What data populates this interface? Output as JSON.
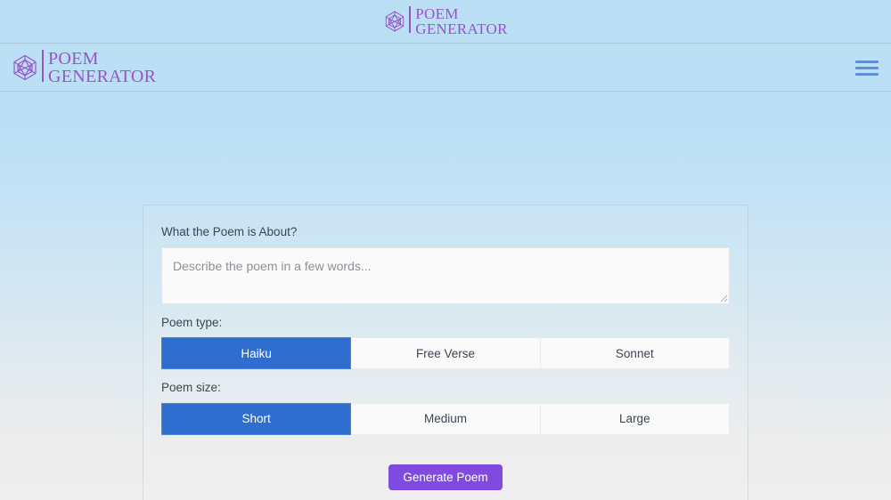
{
  "banner": {
    "logo": {
      "icon": "polyhedron-icon",
      "line1": "POEM",
      "line2": "GENERATOR",
      "color": "#9b52c9"
    }
  },
  "navbar": {
    "logo": {
      "icon": "polyhedron-icon",
      "line1": "POEM",
      "line2": "GENERATOR",
      "color": "#9b52c9"
    },
    "menu_icon": "hamburger-menu-icon",
    "menu_color": "#5b8fd6"
  },
  "form": {
    "topic": {
      "label": "What the Poem is About?",
      "placeholder": "Describe the poem in a few words...",
      "value": ""
    },
    "poem_type": {
      "label": "Poem type:",
      "options": [
        {
          "label": "Haiku",
          "selected": true
        },
        {
          "label": "Free Verse",
          "selected": false
        },
        {
          "label": "Sonnet",
          "selected": false
        }
      ]
    },
    "poem_size": {
      "label": "Poem size:",
      "options": [
        {
          "label": "Short",
          "selected": true
        },
        {
          "label": "Medium",
          "selected": false
        },
        {
          "label": "Large",
          "selected": false
        }
      ]
    },
    "submit": {
      "label": "Generate Poem",
      "color": "#7f4ae0"
    }
  },
  "theme": {
    "accent_blue": "#2f6ecf",
    "accent_purple": "#7f4ae0",
    "banner_bg": "#bbdff5",
    "page_bg_top": "#bbdff5",
    "page_bg_bottom": "#eeeeee"
  }
}
